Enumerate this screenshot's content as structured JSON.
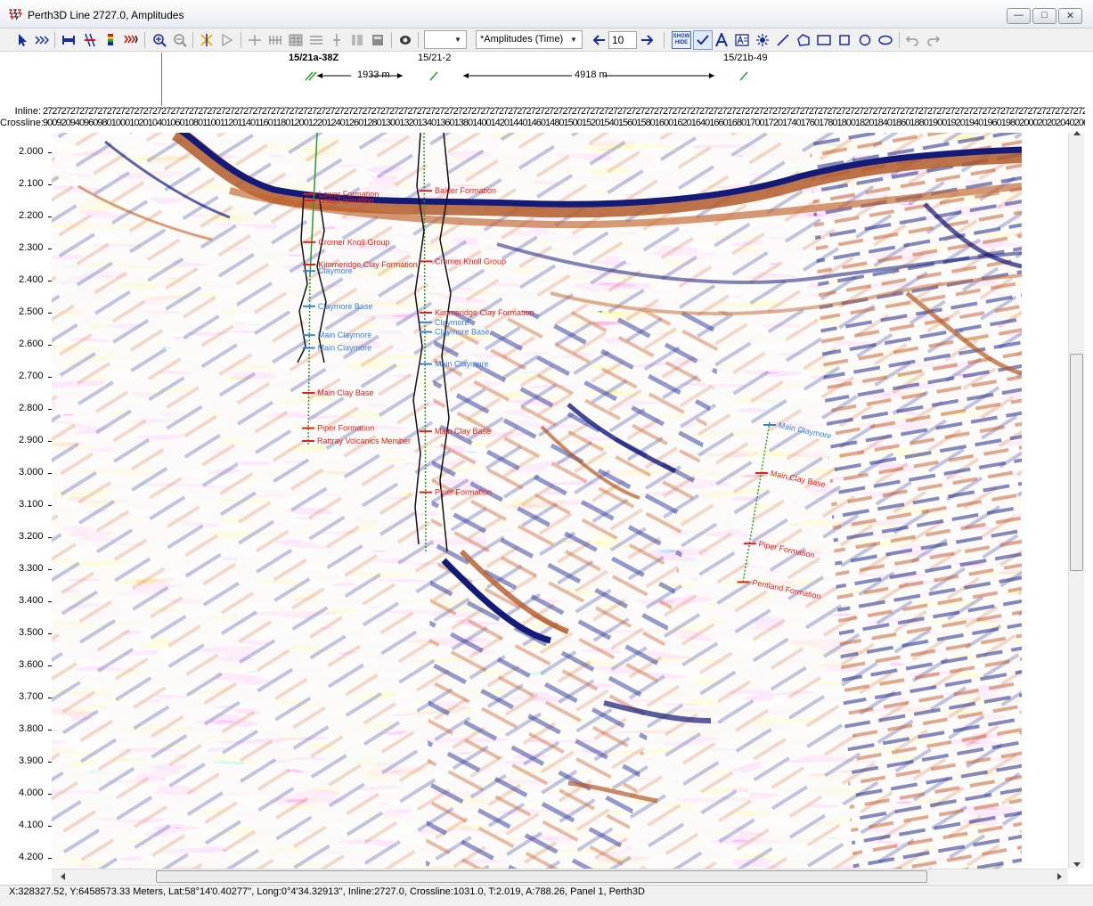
{
  "window": {
    "title": "Perth3D Line 2727.0, Amplitudes",
    "controls": [
      "minimize",
      "maximize",
      "close"
    ]
  },
  "toolbar": {
    "zoom_step": "10",
    "attribute_select": "*Amplitudes (Time)",
    "empty_select": "",
    "show_hide_label": "SHOW HIDE",
    "buttons": [
      "pointer-icon",
      "horizon-pick-icon",
      "flatten-icon",
      "wells-icon",
      "color-bar-icon",
      "wiggle-icon",
      "zoom-in-icon",
      "zoom-out-icon",
      "crossline-icon",
      "flip-icon",
      "fault-icon",
      "grid-icon",
      "table-icon",
      "split-icon",
      "panels-icon",
      "layout-icon",
      "camera-icon",
      "arrow-left-icon",
      "arrow-right-icon",
      "text-icon",
      "annotation-icon",
      "sun-icon",
      "line-icon",
      "polygon-icon",
      "rectangle-icon",
      "square-icon",
      "circle-icon",
      "ellipse-icon",
      "undo-icon",
      "redo-icon"
    ]
  },
  "wells_header": {
    "wells": [
      "15/21a-38Z",
      "15/21-2",
      "15/21b-49"
    ],
    "distances": [
      "1933 m",
      "4918 m"
    ]
  },
  "axis_header": {
    "inline_label": "Inline:",
    "inline_values": "2727272727272727272727272727272727272727272727272727272727272727272727272727272727272727272727272727272727272727272727272727272727272727272727272727272727272727272727272727272727272727272727272727272727272727272727272727272727272727272727272727.0",
    "crossline_label": "Crossline:",
    "crossline_values": "90092094096098010001020104010601080110011201140116011801200122012401260128013001320134013601380140014201440146014801500152015401560158016001620164016601680170017201740176017801800182018401860188019001920194019601980200020202040206020802100212021402160218021,80.0"
  },
  "time_axis": {
    "ticks": [
      "2.000",
      "2.100",
      "2.200",
      "2.300",
      "2.400",
      "2.500",
      "2.600",
      "2.700",
      "2.800",
      "2.900",
      "3.000",
      "3.100",
      "3.200",
      "3.300",
      "3.400",
      "3.500",
      "3.600",
      "3.700",
      "3.800",
      "3.900",
      "4.000",
      "4.100",
      "4.200"
    ]
  },
  "well_markers": {
    "15/21a-38Z": [
      {
        "label": "Lower Formation",
        "time": 2.13,
        "color": "#e0201c"
      },
      {
        "label": "Lista Formation",
        "time": 2.15,
        "color": "#e0201c"
      },
      {
        "label": "Cromer Knoll Group",
        "time": 2.28,
        "color": "#e0201c"
      },
      {
        "label": "Kimmeridge Clay Formation",
        "time": 2.35,
        "color": "#e0201c"
      },
      {
        "label": "Claymore",
        "time": 2.37,
        "color": "#3a7fd8"
      },
      {
        "label": "Claymore Base",
        "time": 2.48,
        "color": "#3a7fd8"
      },
      {
        "label": "Main Claymore",
        "time": 2.57,
        "color": "#3a7fd8"
      },
      {
        "label": "Main Claymore",
        "time": 2.61,
        "color": "#3a7fd8"
      },
      {
        "label": "Main Clay Base",
        "time": 2.75,
        "color": "#e0201c"
      },
      {
        "label": "Piper Formation",
        "time": 2.86,
        "color": "#e0201c"
      },
      {
        "label": "Rattray Volcanics Member",
        "time": 2.9,
        "color": "#e0201c"
      }
    ],
    "15/21-2": [
      {
        "label": "Balder Formation",
        "time": 2.12,
        "color": "#e0201c"
      },
      {
        "label": "Cromer Knoll Group",
        "time": 2.34,
        "color": "#e0201c"
      },
      {
        "label": "Kimmeridge Clay Formation",
        "time": 2.5,
        "color": "#e0201c"
      },
      {
        "label": "Claymore",
        "time": 2.53,
        "color": "#3a7fd8"
      },
      {
        "label": "Claymore Base",
        "time": 2.56,
        "color": "#3a7fd8"
      },
      {
        "label": "Main Claymore",
        "time": 2.66,
        "color": "#3a7fd8"
      },
      {
        "label": "Main Clay Base",
        "time": 2.87,
        "color": "#e0201c"
      },
      {
        "label": "Piper Formation",
        "time": 3.06,
        "color": "#e0201c"
      }
    ],
    "15/21b-49": [
      {
        "label": "Main Claymore",
        "time": 2.85,
        "color": "#3a7fd8"
      },
      {
        "label": "Main Clay Base",
        "time": 3.0,
        "color": "#e0201c"
      },
      {
        "label": "Piper Formation",
        "time": 3.22,
        "color": "#e0201c"
      },
      {
        "label": "Pentland Formation",
        "time": 3.34,
        "color": "#e0201c"
      }
    ]
  },
  "colors": {
    "positive_amplitude": "#1a1f8c",
    "negative_amplitude": "#c0501e",
    "marker_red": "#e0201c",
    "marker_blue": "#3a7fd8",
    "well_path": "#2a9a2a"
  },
  "status_bar": {
    "text": "X:328327.52,  Y:6458573.33 Meters, Lat:58°14'0.40277'', Long:0°4'34.32913'',   Inline:2727.0,  Crossline:1031.0,    T:2.019,   A:788.26,   Panel 1,   Perth3D"
  }
}
